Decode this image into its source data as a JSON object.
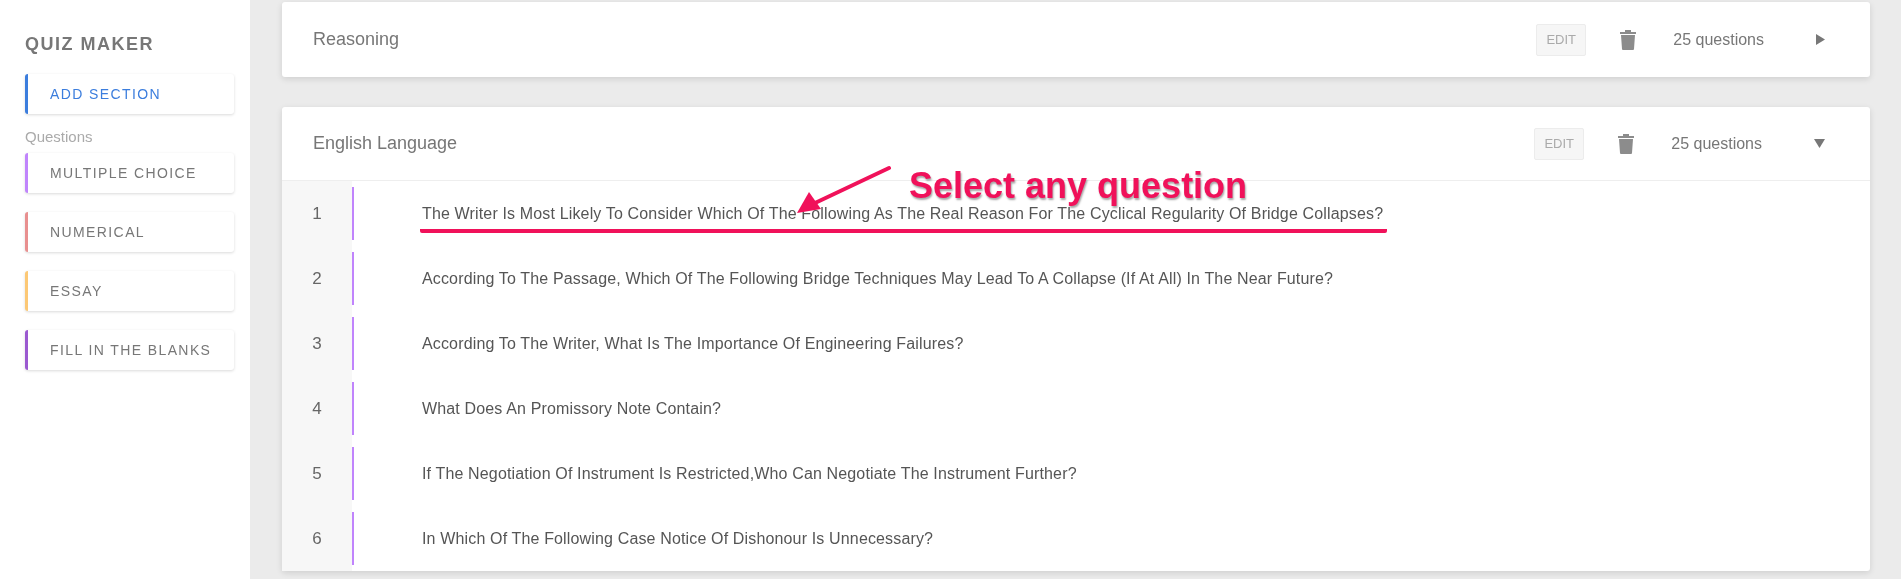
{
  "sidebar": {
    "title": "QUIZ MAKER",
    "add_button": {
      "label": "ADD SECTION",
      "color": "#3b7ddd"
    },
    "group_label": "Questions",
    "items": [
      {
        "label": "MULTIPLE CHOICE",
        "color": "#c084fc"
      },
      {
        "label": "NUMERICAL",
        "color": "#e88f8f"
      },
      {
        "label": "ESSAY",
        "color": "#fcc875"
      },
      {
        "label": "FILL IN THE BLANKS",
        "color": "#9b59d0"
      }
    ]
  },
  "sections": [
    {
      "title": "Reasoning",
      "edit": "EDIT",
      "count": "25 questions",
      "expanded": false
    },
    {
      "title": "English Language",
      "edit": "EDIT",
      "count": "25 questions",
      "expanded": true,
      "questions": [
        {
          "number": "1",
          "text": "The Writer Is Most Likely To Consider Which Of The Following As The Real Reason For The Cyclical Regularity Of Bridge Collapses?",
          "highlighted": true
        },
        {
          "number": "2",
          "text": "According To The Passage, Which Of The Following Bridge Techniques May Lead To A Collapse (If At All) In The Near Future?",
          "highlighted": false
        },
        {
          "number": "3",
          "text": "According To The Writer, What Is The Importance Of Engineering Failures?",
          "highlighted": false
        },
        {
          "number": "4",
          "text": "What Does An Promissory Note Contain?",
          "highlighted": false
        },
        {
          "number": "5",
          "text": "If The Negotiation Of Instrument Is Restricted,Who Can Negotiate The Instrument Further?",
          "highlighted": false
        },
        {
          "number": "6",
          "text": "In Which Of The Following Case Notice Of Dishonour Is Unnecessary?",
          "highlighted": false
        }
      ]
    }
  ],
  "annotation": {
    "text": "Select any question"
  }
}
